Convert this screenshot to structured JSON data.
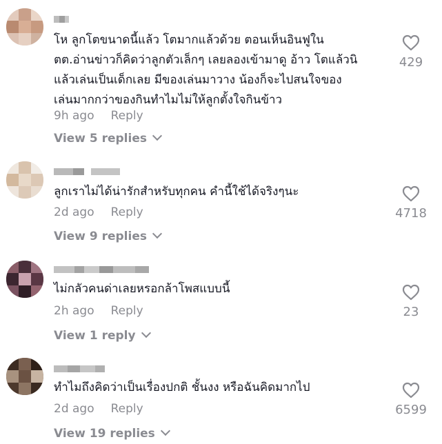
{
  "comments": [
    {
      "username": "",
      "text_lines": [
        "โห ลูกโตขนาดนี้แล้ว โตมากแล้วด้วย ตอนเห็นอินฟูใน",
        "ตต.อ่านข่าวก็คิดว่าลูกตัวเล็กๆ เลยลองเข้ามาดู อ้าว โตแล้วนิ",
        "แล้วเล่นเป็นเด็กเลย มีของเล่นมาวาง น้องก็จะไปสนใจของ",
        "เล่นมากกว่าของกินทำไมไม่ให้ลูกตั้งใจกินข้าว"
      ],
      "time": "9h ago",
      "reply_label": "Reply",
      "view_replies": "View 5 replies",
      "likes": "429"
    },
    {
      "username": "",
      "text_lines": [
        "ลูกเราไม่ได้น่ารักสำหรับทุกคน คำนี้ใช้ได้จริงๆนะ"
      ],
      "time": "2d ago",
      "reply_label": "Reply",
      "view_replies": "View 9 replies",
      "likes": "4718"
    },
    {
      "username": "",
      "text_lines": [
        "ไม่กลัวคนด่าเลยหรอกล้าโพสแบบนี้"
      ],
      "time": "2h ago",
      "reply_label": "Reply",
      "view_replies": "View 1 reply",
      "likes": "23"
    },
    {
      "username": "",
      "text_lines": [
        "ทำไมถึงคิดว่าเป็นเรื่องปกติ ชั้นงง หรือฉันคิดมากไป"
      ],
      "time": "2d ago",
      "reply_label": "Reply",
      "view_replies": "View 19 replies",
      "likes": "6599"
    }
  ],
  "colors": {
    "text": "#161823",
    "muted": "#8a8b91",
    "heart_outline": "#8a8b91"
  },
  "icons": {
    "like": "heart-outline-icon",
    "expand": "chevron-down-icon"
  }
}
